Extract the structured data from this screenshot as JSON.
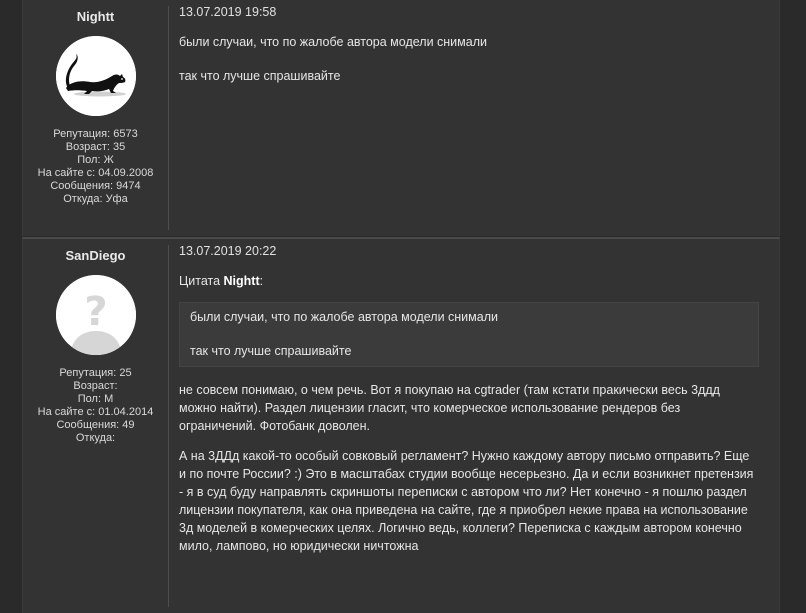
{
  "posts": [
    {
      "username": "Nightt",
      "avatar": "panther-silhouette-avatar",
      "stats": [
        "Репутация: 6573",
        "Возраст: 35",
        "Пол: Ж",
        "На сайте с: 04.09.2008",
        "Сообщения: 9474",
        "Откуда: Уфа"
      ],
      "date": "13.07.2019 19:58",
      "paragraphs": [
        "были случаи, что по жалобе автора модели снимали",
        "так что лучше спрашивайте"
      ]
    },
    {
      "username": "SanDiego",
      "avatar": "question-mark-avatar",
      "stats": [
        "Репутация: 25",
        "Возраст:",
        "Пол: М",
        "На сайте с: 01.04.2014",
        "Сообщения: 49",
        "Откуда:"
      ],
      "date": "13.07.2019 20:22",
      "quote_prefix": "Цитата ",
      "quote_author": "Nightt",
      "quote_suffix": ":",
      "quote_lines": [
        "были случаи, что по жалобе автора модели снимали",
        "так что лучше спрашивайте"
      ],
      "paragraphs": [
        "не совсем понимаю, о чем речь. Вот я покупаю на cgtrader (там кстати пракически весь 3ддд можно найти). Раздел лицензии гласит, что комерческое использование рендеров без ограничений. Фотобанк доволен.",
        "А на 3ДДд какой-то особый совковый регламент? Нужно каждому автору письмо отправить? Еще и по почте России? :) Это в масштабах студии вообще несерьезно. Да и если возникнет претензия - я в суд буду направлять скриншоты переписки с автором что ли? Нет конечно - я пошлю раздел лицензии покупателя, как она приведена на сайте, где я приобрел некие права на использование 3д моделей в комерческих целях. Логично ведь, коллеги? Переписка с каждым автором конечно мило, лампово, но юридически ничтожна"
      ]
    }
  ]
}
